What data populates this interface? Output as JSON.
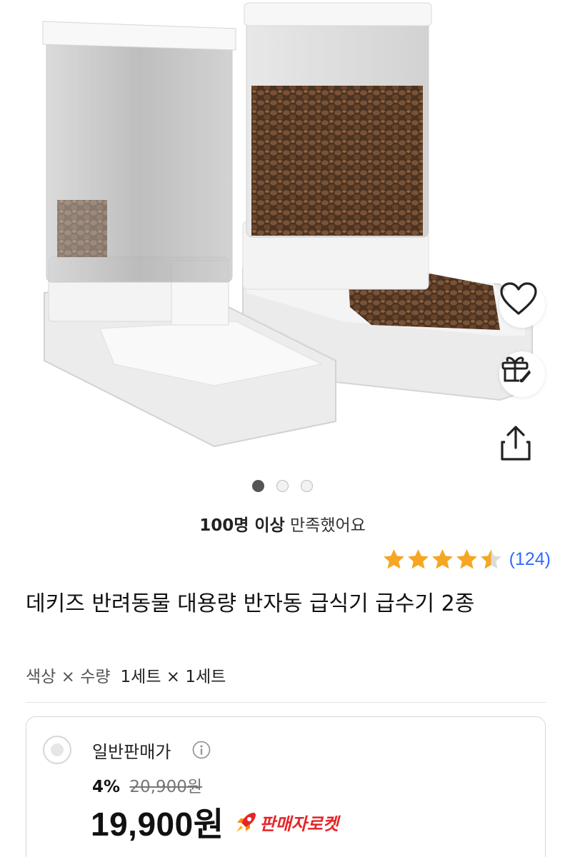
{
  "gallery": {
    "image_alt": "",
    "page_count": 3,
    "active_index": 0
  },
  "actions": {
    "wishlist_icon": "heart-icon",
    "gift_icon": "gift-rocket-icon",
    "share_icon": "share-icon"
  },
  "satisfaction": {
    "bold": "100명 이상",
    "rest": " 만족했어요"
  },
  "rating": {
    "stars": 4.5,
    "max": 5,
    "count_label": "(124)",
    "star_color": "#f5a623"
  },
  "product": {
    "title": "데키즈 반려동물 대용량 반자동 급식기 급수기 2종"
  },
  "options": {
    "label": "색상 × 수량",
    "value": "1세트 × 1세트"
  },
  "price": {
    "sale_type": "일반판매가",
    "discount": "4%",
    "original": "20,900원",
    "final": "19,900원",
    "badge": "판매자로켓",
    "badge_color": "#e52528"
  }
}
